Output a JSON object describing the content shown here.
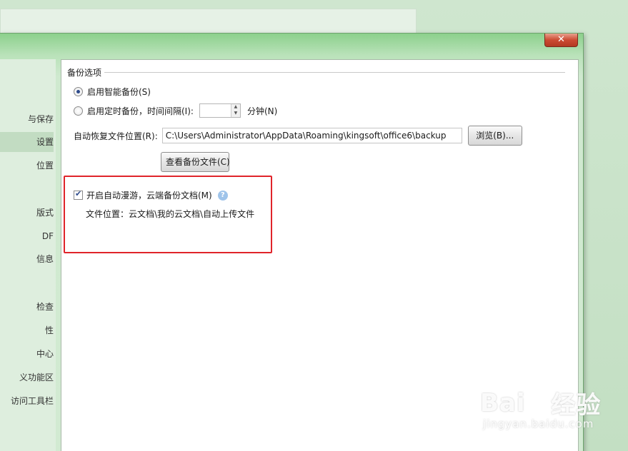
{
  "window": {
    "close_label": "✕"
  },
  "nav": {
    "items": [
      {
        "label": "与保存",
        "active": false
      },
      {
        "label": "设置",
        "active": true
      },
      {
        "label": "位置",
        "active": false
      },
      {
        "label": "版式",
        "active": false
      },
      {
        "label": "DF",
        "active": false
      },
      {
        "label": "信息",
        "active": false
      },
      {
        "label": "检查",
        "active": false
      },
      {
        "label": "性",
        "active": false
      },
      {
        "label": "中心",
        "active": false
      },
      {
        "label": "义功能区",
        "active": false
      },
      {
        "label": "访问工具栏",
        "active": false
      }
    ]
  },
  "backup": {
    "group_title": "备份选项",
    "smart_backup_label": "启用智能备份(S)",
    "smart_backup_checked": true,
    "timed_backup_label": "启用定时备份，时间间隔(I):",
    "timed_backup_checked": false,
    "interval_value": "",
    "interval_unit": "分钟(N)",
    "path_label": "自动恢复文件位置(R):",
    "path_value": "C:\\Users\\Administrator\\AppData\\Roaming\\kingsoft\\office6\\backup",
    "browse_button": "浏览(B)...",
    "view_backup_button": "查看备份文件(C)"
  },
  "cloud": {
    "roaming_label": "开启自动漫游，云端备份文档(M)",
    "roaming_checked": true,
    "help_icon": "?",
    "file_location": "文件位置：云文档\\我的云文档\\自动上传文件"
  },
  "watermark": {
    "logo_left": "Bai",
    "logo_right": "经验",
    "url": "jingyan.baidu.com"
  },
  "colors": {
    "highlight": "#e0242a",
    "accent_green": "#8cd08c"
  }
}
